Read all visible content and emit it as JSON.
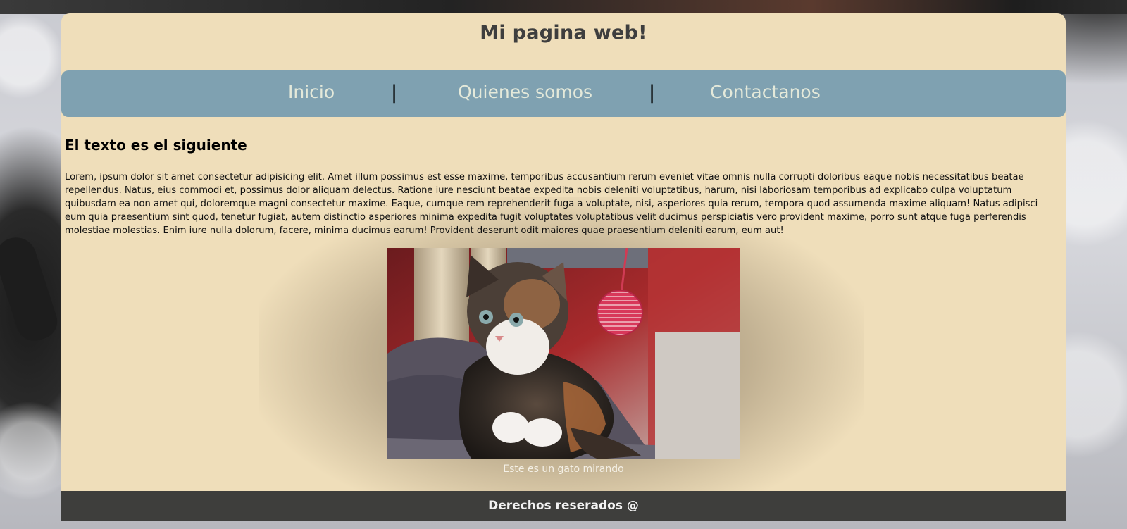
{
  "site": {
    "title": "Mi pagina web!"
  },
  "nav": {
    "items": [
      {
        "label": "Inicio"
      },
      {
        "label": "Quienes somos"
      },
      {
        "label": "Contactanos"
      }
    ],
    "separator": "|"
  },
  "content": {
    "heading": "El texto es el siguiente",
    "paragraph": "Lorem, ipsum dolor sit amet consectetur adipisicing elit. Amet illum possimus est esse maxime, temporibus accusantium rerum eveniet vitae omnis nulla corrupti doloribus eaque nobis necessitatibus beatae repellendus. Natus, eius commodi et, possimus dolor aliquam delectus. Ratione iure nesciunt beatae expedita nobis deleniti voluptatibus, harum, nisi laboriosam temporibus ad explicabo culpa voluptatum quibusdam ea non amet qui, doloremque magni consectetur maxime. Eaque, cumque rem reprehenderit fuga a voluptate, nisi, asperiores quia rerum, tempora quod assumenda maxime aliquam! Natus adipisci eum quia praesentium sint quod, tenetur fugiat, autem distinctio asperiores minima expedita fugit voluptates voluptatibus velit ducimus perspiciatis vero provident maxime, porro sunt atque fuga perferendis molestiae molestias. Enim iure nulla dolorum, facere, minima ducimus earum! Provident deserunt odit maiores quae praesentium deleniti earum, eum aut!",
    "image_icon": "kitten-photo",
    "caption": "Este es un gato mirando"
  },
  "footer": {
    "text": "Derechos reserados @"
  },
  "colors": {
    "page_bg": "#efdeba",
    "nav_bg": "#7fa1b1",
    "nav_text": "#e4e9da",
    "footer_bg": "#3e3e3c",
    "title_text": "#3e3e3e"
  }
}
